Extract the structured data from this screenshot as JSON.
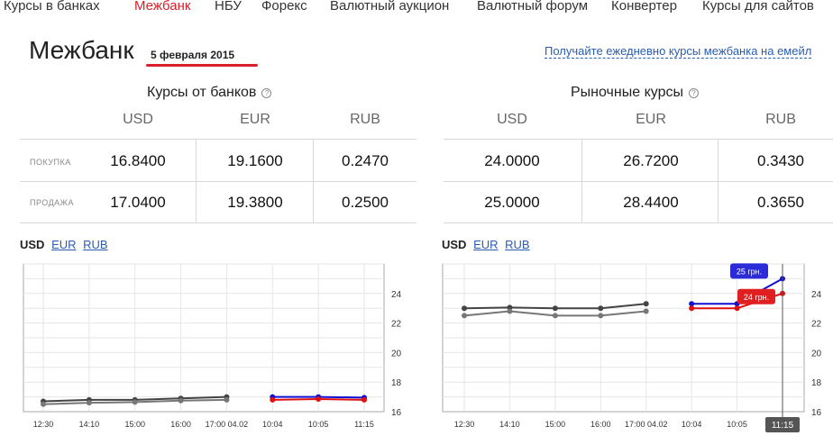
{
  "nav": {
    "items": [
      "Курсы в банках",
      "Межбанк",
      "НБУ",
      "Форекс",
      "Валютный аукцион",
      "Валютный форум",
      "Конвертер",
      "Курсы для сайтов"
    ],
    "active_index": 1
  },
  "page": {
    "title": "Межбанк",
    "date": "5 февраля 2015",
    "subscribe_link": "Получайте ежедневно курсы межбанка на емейл",
    "accent_color": "#d9202a",
    "link_color": "#2a5db0"
  },
  "bank_rates": {
    "title": "Курсы от банков",
    "help_icon": "help-icon",
    "currencies": [
      "USD",
      "EUR",
      "RUB"
    ],
    "rows": [
      {
        "label": "ПОКУПКА",
        "values": [
          "16.8400",
          "19.1600",
          "0.2470"
        ]
      },
      {
        "label": "ПРОДАЖА",
        "values": [
          "17.0400",
          "19.3800",
          "0.2500"
        ]
      }
    ]
  },
  "market_rates": {
    "title": "Рыночные курсы",
    "help_icon": "help-icon",
    "currencies": [
      "USD",
      "EUR",
      "RUB"
    ],
    "rows": [
      {
        "values": [
          "24.0000",
          "26.7200",
          "0.3430"
        ]
      },
      {
        "values": [
          "25.0000",
          "28.4400",
          "0.3650"
        ]
      }
    ]
  },
  "chart_tabs": {
    "current": "USD",
    "links": [
      "EUR",
      "RUB"
    ]
  },
  "chart_data": [
    {
      "type": "line",
      "categories": [
        "12:30",
        "14:10",
        "15:00",
        "16:00",
        "17:00 04.02",
        "10:04",
        "10:05",
        "11:15"
      ],
      "ylim": [
        16,
        26
      ],
      "yticks": [
        16,
        18,
        20,
        22,
        24
      ],
      "grid": true,
      "series": [
        {
          "color": "#444444",
          "values": [
            16.7,
            16.8,
            16.8,
            16.9,
            17.0,
            null,
            null,
            null
          ]
        },
        {
          "color": "#777777",
          "values": [
            16.5,
            16.6,
            16.65,
            16.75,
            16.8,
            null,
            null,
            null
          ]
        },
        {
          "color": "#1010d0",
          "values": [
            null,
            null,
            null,
            null,
            null,
            17.0,
            17.0,
            16.95
          ]
        },
        {
          "color": "#e01010",
          "values": [
            null,
            null,
            null,
            null,
            null,
            16.8,
            16.85,
            16.8
          ]
        }
      ]
    },
    {
      "type": "line",
      "categories": [
        "12:30",
        "14:10",
        "15:00",
        "16:00",
        "17:00 04.02",
        "10:04",
        "10:05",
        "11:15"
      ],
      "ylim": [
        16,
        26
      ],
      "yticks": [
        16,
        18,
        20,
        22,
        24
      ],
      "grid": true,
      "series": [
        {
          "color": "#444444",
          "values": [
            23.0,
            23.05,
            23.0,
            23.0,
            23.3,
            null,
            null,
            null
          ]
        },
        {
          "color": "#777777",
          "values": [
            22.5,
            22.8,
            22.5,
            22.5,
            22.8,
            null,
            null,
            null
          ]
        },
        {
          "color": "#1010d0",
          "values": [
            null,
            null,
            null,
            null,
            null,
            23.3,
            23.3,
            25.0
          ]
        },
        {
          "color": "#e01010",
          "values": [
            null,
            null,
            null,
            null,
            null,
            23.0,
            23.0,
            24.0
          ]
        }
      ],
      "annotations": [
        {
          "text": "25 грн.",
          "color": "#2b2bd8"
        },
        {
          "text": "24 грн.",
          "color": "#e02020"
        }
      ],
      "crosshair_label": "11:15"
    }
  ]
}
